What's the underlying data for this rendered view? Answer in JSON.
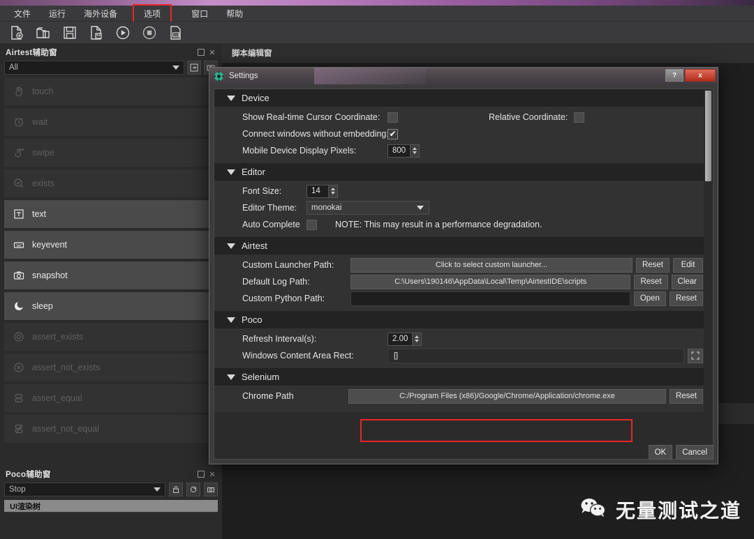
{
  "menubar": {
    "items": [
      {
        "label": "文件",
        "highlighted": false
      },
      {
        "label": "运行",
        "highlighted": false
      },
      {
        "label": "海外设备",
        "highlighted": false
      },
      {
        "label": "选项",
        "highlighted": true
      },
      {
        "label": "窗口",
        "highlighted": false
      },
      {
        "label": "帮助",
        "highlighted": false
      }
    ],
    "highlight_color": "#e8262a"
  },
  "toolbar": {
    "buttons": [
      {
        "name": "new-file-icon"
      },
      {
        "name": "open-folder-icon"
      },
      {
        "name": "save-icon"
      },
      {
        "name": "save-as-icon"
      },
      {
        "name": "run-icon"
      },
      {
        "name": "stop-icon"
      },
      {
        "name": "log-icon"
      }
    ]
  },
  "airtest_dock": {
    "title": "Airtest辅助窗",
    "filter": {
      "value": "All",
      "placeholder": "All"
    },
    "items": [
      {
        "label": "touch",
        "icon": "hand-touch-icon",
        "active": false
      },
      {
        "label": "wait",
        "icon": "clock-icon",
        "active": false
      },
      {
        "label": "swipe",
        "icon": "swipe-hand-icon",
        "active": false
      },
      {
        "label": "exists",
        "icon": "magnifier-check-icon",
        "active": false
      },
      {
        "label": "text",
        "icon": "text-box-icon",
        "active": true
      },
      {
        "label": "keyevent",
        "icon": "keyboard-icon",
        "active": true
      },
      {
        "label": "snapshot",
        "icon": "camera-icon",
        "active": true
      },
      {
        "label": "sleep",
        "icon": "moon-icon",
        "active": true
      },
      {
        "label": "assert_exists",
        "icon": "target-circle-icon",
        "active": false
      },
      {
        "label": "assert_not_exists",
        "icon": "cross-circle-icon",
        "active": false
      },
      {
        "label": "assert_equal",
        "icon": "equal-blocks-icon",
        "active": false
      },
      {
        "label": "assert_not_equal",
        "icon": "not-equal-blocks-icon",
        "active": false
      }
    ]
  },
  "poco_dock": {
    "title": "Poco辅助窗",
    "mode": {
      "value": "Stop"
    },
    "tree_header": "UI渲染树",
    "buttons": [
      {
        "name": "lock-icon"
      },
      {
        "name": "refresh-icon"
      },
      {
        "name": "screenshot-icon"
      }
    ]
  },
  "editor": {
    "tab_label": "脚本编辑窗"
  },
  "settings_dialog": {
    "title": "Settings",
    "titlebar_buttons": [
      {
        "name": "help-button",
        "label": "?"
      },
      {
        "name": "close-button",
        "label": "x"
      }
    ],
    "sections": {
      "device": {
        "header": "Device",
        "show_cursor_label": "Show Real-time Cursor Coordinate:",
        "show_cursor_checked": false,
        "relative_coord_label": "Relative Coordinate:",
        "relative_coord_checked": false,
        "connect_without_embed_label": "Connect windows without embedding:",
        "connect_without_embed_checked": true,
        "mobile_pixels_label": "Mobile Device Display Pixels:",
        "mobile_pixels_value": "800"
      },
      "editor": {
        "header": "Editor",
        "font_size_label": "Font Size:",
        "font_size_value": "14",
        "theme_label": "Editor Theme:",
        "theme_value": "monokai",
        "auto_complete_label": "Auto Complete",
        "auto_complete_checked": false,
        "auto_complete_note": "NOTE: This may result in a performance degradation."
      },
      "airtest": {
        "header": "Airtest",
        "rows": [
          {
            "label": "Custom Launcher Path:",
            "value": "Click to select custom launcher...",
            "value_empty": false,
            "buttons": [
              "Reset",
              "Edit"
            ]
          },
          {
            "label": "Default Log Path:",
            "value": "C:\\Users\\190146\\AppData\\Local\\Temp\\AirtestIDE\\scripts",
            "value_empty": false,
            "buttons": [
              "Reset",
              "Clear"
            ]
          },
          {
            "label": "Custom Python Path:",
            "value": "",
            "value_empty": true,
            "buttons": [
              "Open",
              "Reset"
            ]
          }
        ]
      },
      "poco": {
        "header": "Poco",
        "refresh_label": "Refresh Interval(s):",
        "refresh_value": "2.00",
        "rect_label": "Windows Content Area Rect:",
        "rect_value": "[]",
        "rect_button": "fullscreen-pick-icon"
      },
      "selenium": {
        "header": "Selenium",
        "chrome_path_label": "Chrome Path",
        "chrome_path_value": "C:/Program Files (x86)/Google/Chrome/Application/chrome.exe",
        "chrome_path_reset": "Reset",
        "highlight_color": "#e8262a"
      }
    },
    "footer": {
      "ok_label": "OK",
      "cancel_label": "Cancel"
    }
  },
  "watermark": {
    "text": "无量测试之道",
    "icon": "wechat-icon"
  }
}
